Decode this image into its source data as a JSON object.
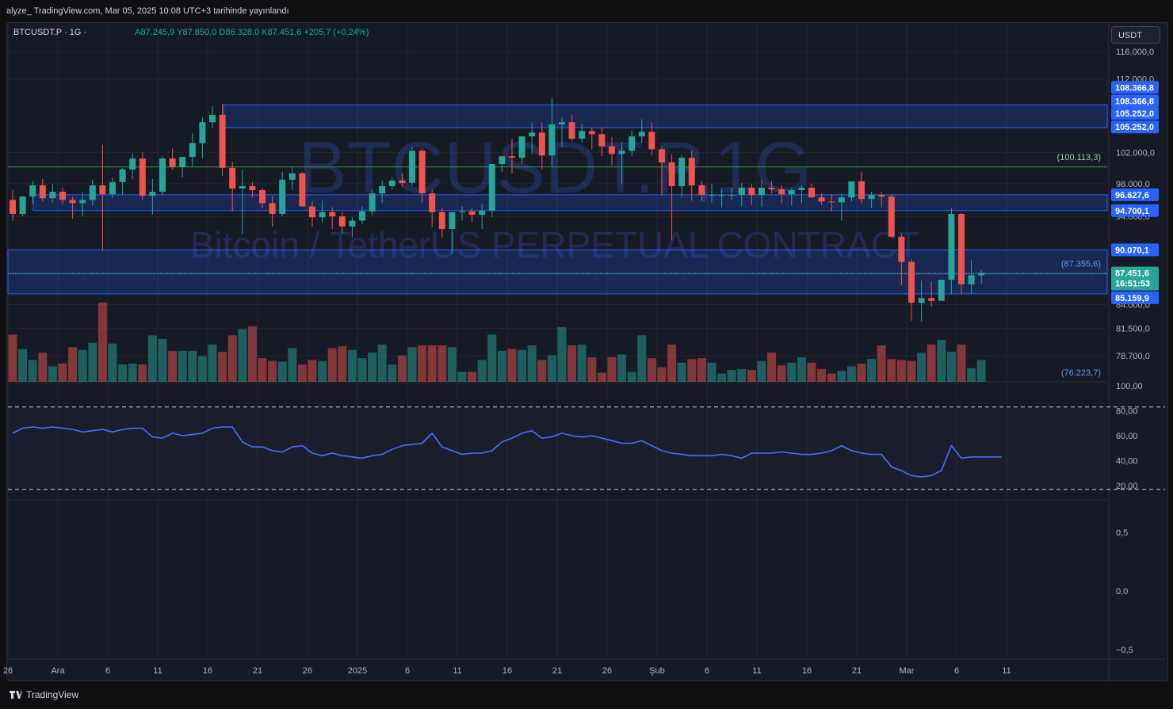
{
  "header": {
    "publish_line": "alyze_ TradingView.com, Mar 05, 2025 10:08 UTC+3 tarihinde yayınlandı"
  },
  "legend": {
    "symbol": "BTCUSDT.P · 1G ·",
    "ohlc": "A87.245,9 Y87.850,0 D86.328,0 K87.451,6 +205,7 (+0,24%)"
  },
  "currency_button": "USDT",
  "watermark": {
    "symbol": "BTCUSDT.P,1G",
    "description": "Bitcoin / TetherUS PERPETUAL CONTRACT"
  },
  "footer": {
    "brand": "TradingView"
  },
  "colors": {
    "background": "#161a25",
    "bull": "#26a69a",
    "bear": "#ef5350",
    "zone_blue": "#2962ff",
    "rsi_line": "#4c6ef5",
    "level_green": "#4caf50"
  },
  "chart_data": [
    {
      "type": "candlestick",
      "title": "BTCUSDT.P, 1G",
      "y_scale": "log",
      "ylim": [
        74500,
        118000
      ],
      "y_ticks": [
        "116.000,0",
        "112.000,0",
        "102.000,0",
        "98.000,0",
        "94.000,0",
        "84.000,0",
        "81.500,0",
        "78.700,0"
      ],
      "x_ticks": [
        "26",
        "Ara",
        "6",
        "11",
        "16",
        "21",
        "26",
        "2025",
        "6",
        "11",
        "16",
        "21",
        "26",
        "Şub",
        "6",
        "11",
        "16",
        "21",
        "Mar",
        "6",
        "11"
      ],
      "ohlc": [
        [
          96000,
          97200,
          93500,
          94300
        ],
        [
          94300,
          96500,
          94000,
          96400
        ],
        [
          96400,
          98300,
          95500,
          97800
        ],
        [
          97800,
          98600,
          95800,
          96200
        ],
        [
          96200,
          98000,
          95700,
          97000
        ],
        [
          97000,
          97500,
          95500,
          96000
        ],
        [
          96000,
          96400,
          93700,
          95600
        ],
        [
          95600,
          97000,
          94000,
          96000
        ],
        [
          96000,
          98500,
          95300,
          97800
        ],
        [
          97800,
          103000,
          90000,
          96700
        ],
        [
          96700,
          98800,
          96200,
          98200
        ],
        [
          98200,
          100000,
          96600,
          99800
        ],
        [
          99800,
          101800,
          98600,
          101200
        ],
        [
          101200,
          102000,
          96000,
          96500
        ],
        [
          96500,
          98600,
          94200,
          97000
        ],
        [
          97000,
          101500,
          96600,
          101200
        ],
        [
          101200,
          102500,
          99800,
          100100
        ],
        [
          100100,
          101300,
          98800,
          101400
        ],
        [
          101400,
          104500,
          100100,
          103200
        ],
        [
          103200,
          106600,
          101200,
          106000
        ],
        [
          106000,
          108200,
          105200,
          107000
        ],
        [
          107000,
          108500,
          99000,
          100000
        ],
        [
          100000,
          100800,
          94600,
          97400
        ],
        [
          97400,
          99800,
          91900,
          97700
        ],
        [
          97700,
          98200,
          96300,
          97200
        ],
        [
          97200,
          97500,
          95000,
          95600
        ],
        [
          95600,
          96500,
          92800,
          94300
        ],
        [
          94300,
          99500,
          94000,
          98500
        ],
        [
          98500,
          100200,
          97200,
          99300
        ],
        [
          99300,
          99500,
          95400,
          95200
        ],
        [
          95200,
          95800,
          92800,
          93900
        ],
        [
          93900,
          95900,
          93200,
          94500
        ],
        [
          94500,
          95100,
          92500,
          94000
        ],
        [
          94000,
          94500,
          92000,
          92800
        ],
        [
          92800,
          93900,
          91500,
          93500
        ],
        [
          93500,
          95200,
          93100,
          94600
        ],
        [
          94600,
          97300,
          94100,
          96800
        ],
        [
          96800,
          98400,
          95600,
          97700
        ],
        [
          97700,
          98800,
          97300,
          98400
        ],
        [
          98400,
          99300,
          97600,
          98100
        ],
        [
          98100,
          102700,
          97800,
          102200
        ],
        [
          102200,
          102500,
          95600,
          96800
        ],
        [
          96800,
          97300,
          92700,
          94500
        ],
        [
          94500,
          95000,
          91500,
          92500
        ],
        [
          92500,
          94500,
          89500,
          94500
        ],
        [
          94500,
          95200,
          93500,
          94600
        ],
        [
          94600,
          95000,
          93300,
          94200
        ],
        [
          94200,
          95500,
          92500,
          94700
        ],
        [
          94700,
          100000,
          93900,
          100500
        ],
        [
          100500,
          101300,
          99500,
          101500
        ],
        [
          101500,
          103800,
          99300,
          101300
        ],
        [
          101300,
          104000,
          100500,
          104100
        ],
        [
          104100,
          105900,
          101800,
          104600
        ],
        [
          104600,
          106000,
          99800,
          101600
        ],
        [
          101600,
          109300,
          100100,
          105700
        ],
        [
          105700,
          106600,
          102700,
          106000
        ],
        [
          106000,
          107000,
          103500,
          103800
        ],
        [
          103800,
          105800,
          103300,
          104800
        ],
        [
          104800,
          105300,
          102400,
          104400
        ],
        [
          104400,
          105300,
          101500,
          102800
        ],
        [
          102800,
          104000,
          100300,
          101800
        ],
        [
          101800,
          103300,
          97900,
          102200
        ],
        [
          102200,
          104900,
          101500,
          104100
        ],
        [
          104100,
          106400,
          103200,
          104700
        ],
        [
          104700,
          106000,
          101600,
          102400
        ],
        [
          102400,
          102800,
          96500,
          100700
        ],
        [
          100700,
          101800,
          91200,
          97700
        ],
        [
          97700,
          101600,
          96300,
          101300
        ],
        [
          101300,
          102200,
          95900,
          97800
        ],
        [
          97800,
          98300,
          95900,
          96600
        ],
        [
          96600,
          98000,
          95700,
          96600
        ],
        [
          96600,
          97300,
          95100,
          96600
        ],
        [
          96600,
          97500,
          96000,
          96600
        ],
        [
          96600,
          98100,
          95200,
          97500
        ],
        [
          97500,
          98000,
          95400,
          96600
        ],
        [
          96600,
          98500,
          95200,
          97500
        ],
        [
          97500,
          98300,
          96800,
          97300
        ],
        [
          97300,
          97800,
          95600,
          96700
        ],
        [
          96700,
          97500,
          95300,
          97200
        ],
        [
          97200,
          97800,
          95600,
          97500
        ],
        [
          97500,
          98000,
          96300,
          96300
        ],
        [
          96300,
          96800,
          95400,
          95800
        ],
        [
          95800,
          96700,
          94600,
          95700
        ],
        [
          95700,
          96800,
          93500,
          96300
        ],
        [
          96300,
          98000,
          95800,
          98300
        ],
        [
          98300,
          99500,
          95600,
          96100
        ],
        [
          96100,
          97000,
          95000,
          96600
        ],
        [
          96600,
          97000,
          95100,
          96400
        ],
        [
          96400,
          96700,
          91500,
          91600
        ],
        [
          91600,
          92000,
          86100,
          88700
        ],
        [
          88700,
          89000,
          82300,
          84200
        ],
        [
          84200,
          86600,
          82200,
          84700
        ],
        [
          84700,
          86500,
          83800,
          84400
        ],
        [
          84400,
          86000,
          85000,
          86700
        ],
        [
          86700,
          95000,
          85100,
          94300
        ],
        [
          94300,
          94400,
          85100,
          86200
        ],
        [
          86200,
          88900,
          85100,
          87200
        ],
        [
          87200,
          87800,
          86300,
          87450
        ]
      ],
      "volume_relative": [
        0.52,
        0.36,
        0.24,
        0.32,
        0.17,
        0.2,
        0.38,
        0.35,
        0.43,
        0.87,
        0.42,
        0.19,
        0.2,
        0.19,
        0.51,
        0.47,
        0.34,
        0.34,
        0.34,
        0.28,
        0.41,
        0.33,
        0.51,
        0.58,
        0.61,
        0.26,
        0.23,
        0.22,
        0.37,
        0.19,
        0.24,
        0.23,
        0.37,
        0.39,
        0.35,
        0.26,
        0.32,
        0.41,
        0.19,
        0.29,
        0.38,
        0.4,
        0.4,
        0.4,
        0.38,
        0.11,
        0.11,
        0.24,
        0.52,
        0.34,
        0.36,
        0.35,
        0.4,
        0.24,
        0.29,
        0.6,
        0.4,
        0.41,
        0.27,
        0.1,
        0.27,
        0.3,
        0.11,
        0.51,
        0.26,
        0.16,
        0.41,
        0.21,
        0.25,
        0.26,
        0.21,
        0.09,
        0.13,
        0.14,
        0.13,
        0.23,
        0.32,
        0.18,
        0.21,
        0.27,
        0.21,
        0.14,
        0.09,
        0.12,
        0.17,
        0.2,
        0.25,
        0.4,
        0.25,
        0.24,
        0.23,
        0.32,
        0.41,
        0.46,
        0.33,
        0.41,
        0.15,
        0.24,
        0.09,
        0.24
      ],
      "levels": [
        {
          "label": "108.366,8",
          "value": 108366.8,
          "style": "zone_top"
        },
        {
          "label": "105.252,0",
          "value": 105252.0,
          "style": "zone_bottom"
        },
        {
          "label": "96.627,6",
          "value": 96627.6,
          "style": "zone_top"
        },
        {
          "label": "94.700,1",
          "value": 94700.1,
          "style": "zone_bottom"
        },
        {
          "label": "90.070,1",
          "value": 90070.1,
          "style": "zone_top"
        },
        {
          "label": "85.159,9",
          "value": 85159.9,
          "style": "zone_bottom"
        }
      ],
      "high_marker": "(100.113,3)",
      "mid_marker": "(87.355,6)",
      "low_marker": "(76.223,7)",
      "last_price": "87.451,6",
      "countdown": "16:51:53"
    },
    {
      "type": "line",
      "title": "RSI",
      "ylim": [
        0,
        100
      ],
      "y_ticks": [
        "100,00",
        "80,00",
        "60,00",
        "40,00",
        "20,00"
      ],
      "bands": [
        30,
        70
      ],
      "values": [
        62,
        66,
        67,
        66,
        67,
        66,
        65,
        63,
        64,
        65,
        63,
        65,
        66,
        66,
        59,
        58,
        62,
        60,
        61,
        62,
        66,
        67,
        67,
        55,
        51,
        51,
        48,
        47,
        51,
        52,
        46,
        44,
        46,
        44,
        43,
        42,
        44,
        45,
        49,
        52,
        53,
        54,
        62,
        51,
        48,
        45,
        46,
        46,
        48,
        55,
        58,
        62,
        64,
        58,
        59,
        62,
        60,
        59,
        60,
        58,
        56,
        54,
        54,
        56,
        52,
        48,
        46,
        45,
        44,
        44,
        44,
        45,
        44,
        42,
        46,
        46,
        46,
        47,
        46,
        45,
        45,
        46,
        48,
        52,
        48,
        46,
        45,
        45,
        35,
        32,
        28,
        27,
        28,
        32,
        52,
        42,
        43,
        43,
        43,
        43
      ]
    },
    {
      "type": "line",
      "title": "",
      "y_ticks": [
        "0,5",
        "0,0",
        "−0,5"
      ],
      "ylim": [
        -0.6,
        0.6
      ]
    }
  ]
}
